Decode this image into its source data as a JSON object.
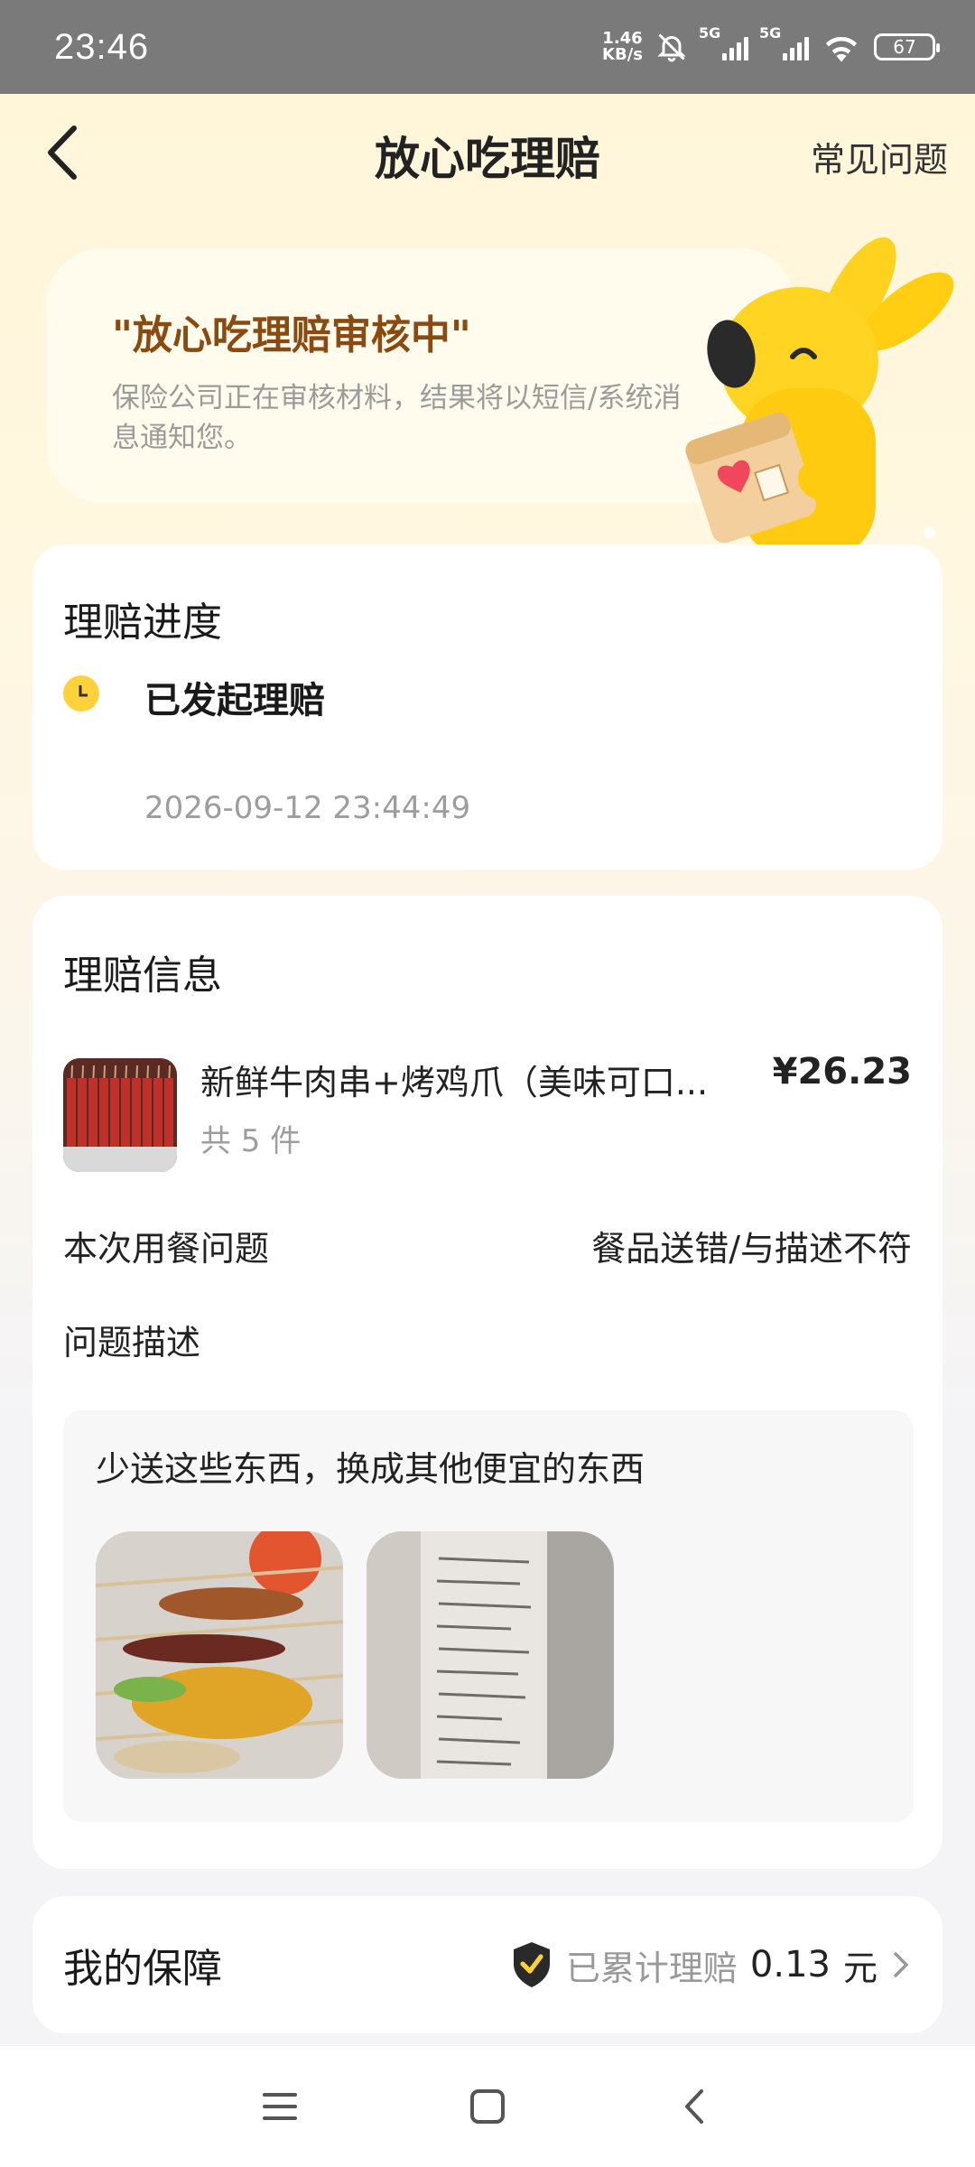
{
  "status": {
    "time": "23:46",
    "speed_value": "1.46",
    "speed_unit": "KB/s",
    "net1": "5G",
    "net2": "5G",
    "battery": "67"
  },
  "header": {
    "title": "放心吃理赔",
    "faq": "常见问题"
  },
  "banner": {
    "title": "\"放心吃理赔审核中\"",
    "desc": "保险公司正在审核材料，结果将以短信/系统消息通知您。"
  },
  "progress": {
    "title": "理赔进度",
    "steps": [
      {
        "label": "已发起理赔",
        "time": "2026-09-12 23:44:49"
      }
    ]
  },
  "info": {
    "title": "理赔信息",
    "product": {
      "name": "新鲜牛肉串+烤鸡爪（美味可口...",
      "qty": "共 5 件",
      "price": "¥26.23"
    },
    "issue_label": "本次用餐问题",
    "issue_value": "餐品送错/与描述不符",
    "desc_label": "问题描述",
    "desc_text": "少送这些东西，换成其他便宜的东西"
  },
  "guarantee": {
    "title": "我的保障",
    "text": "已累计理赔",
    "amount": "0.13",
    "unit": "元"
  },
  "colors": {
    "accent": "#ffd23c",
    "brand_text": "#8a4a10",
    "status_bar": "#7a7a7a"
  }
}
